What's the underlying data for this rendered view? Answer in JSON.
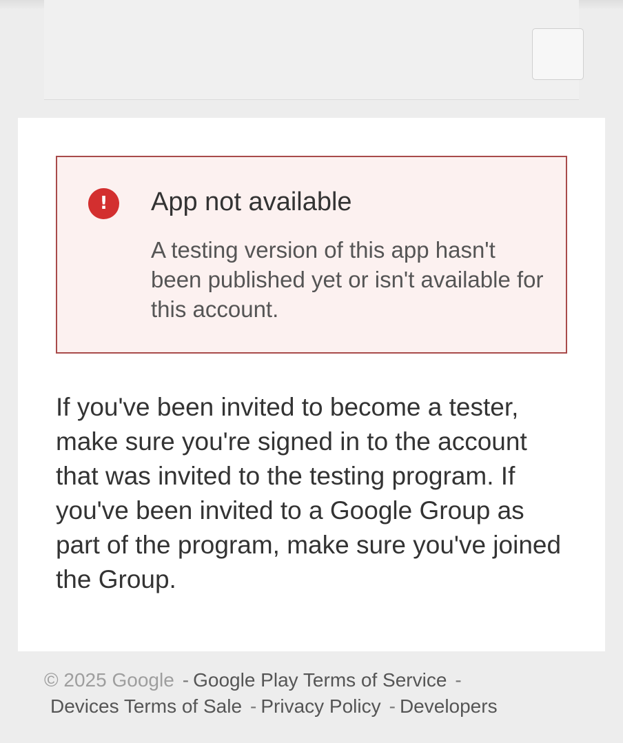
{
  "alert": {
    "icon": "error-exclamation-icon",
    "title": "App not available",
    "message": "A testing version of this app hasn't been published yet or isn't available for this account."
  },
  "info": {
    "text": "If you've been invited to become a tester, make sure you're signed in to the account that was invited to the testing program. If you've been invited to a Google Group as part of the program, make sure you've joined the Group."
  },
  "footer": {
    "copyright": "© 2025 Google",
    "separator": "-",
    "links": [
      "Google Play Terms of Service",
      "Devices Terms of Sale",
      "Privacy Policy",
      "Developers"
    ]
  },
  "colors": {
    "alert_accent": "#d32f2f",
    "alert_border": "#a84a4a",
    "alert_background": "#fcf1f0",
    "page_background": "#ededed"
  }
}
